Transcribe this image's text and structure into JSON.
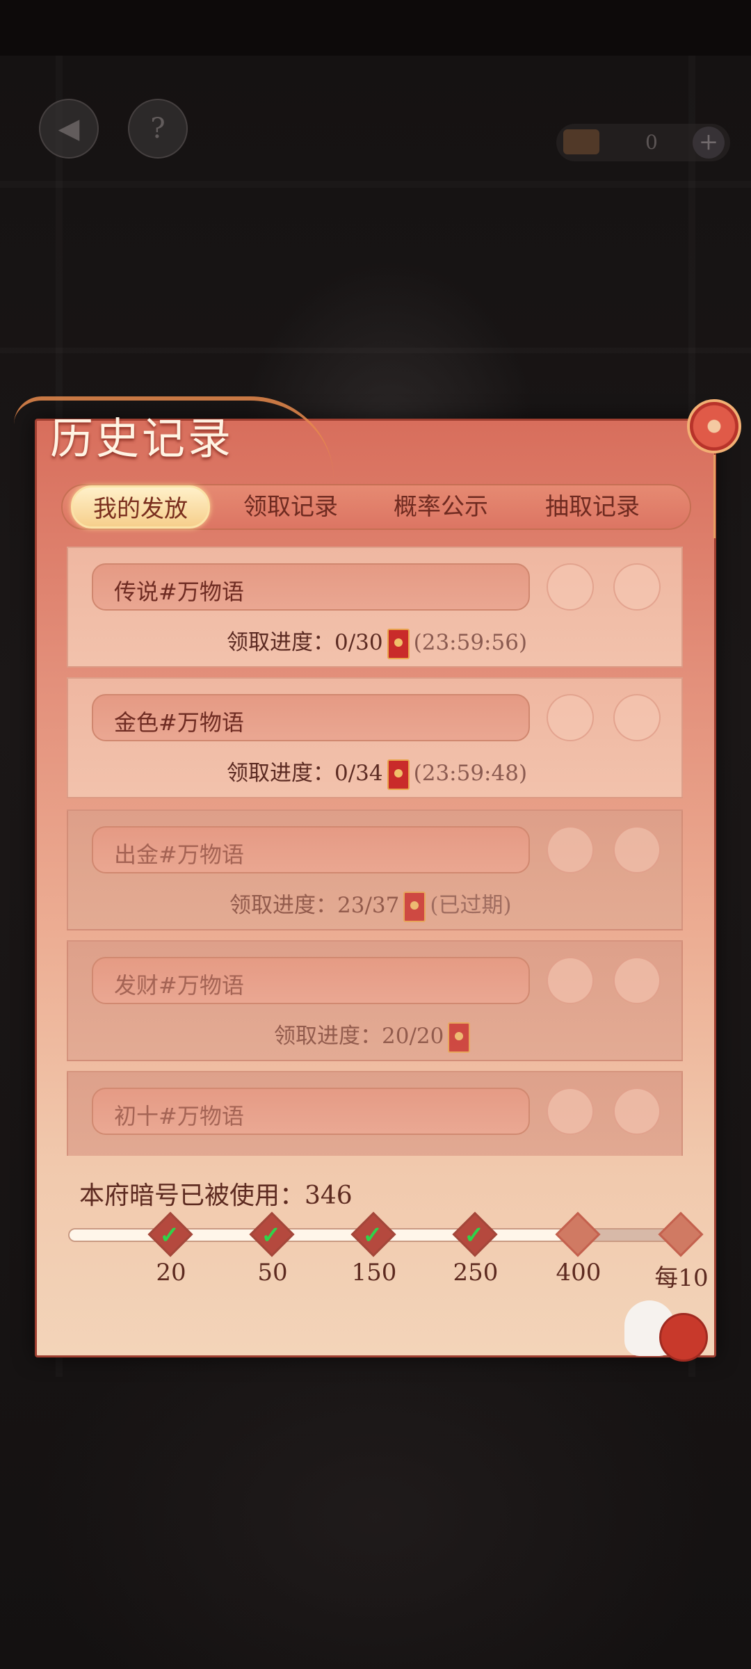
{
  "topbar": {
    "back_icon": "back-arrow-icon",
    "help_label": "?",
    "currency_value": "0",
    "currency_add": "+"
  },
  "panel": {
    "title": "历史记录"
  },
  "tabs": [
    {
      "label": "我的发放",
      "active": true
    },
    {
      "label": "领取记录",
      "active": false
    },
    {
      "label": "概率公示",
      "active": false
    },
    {
      "label": "抽取记录",
      "active": false
    }
  ],
  "records": [
    {
      "code": "传说#万物语",
      "progress_label": "领取进度：",
      "progress": "0/30",
      "note": "(23:59:56)",
      "expired": false
    },
    {
      "code": "金色#万物语",
      "progress_label": "领取进度：",
      "progress": "0/34",
      "note": "(23:59:48)",
      "expired": false
    },
    {
      "code": "出金#万物语",
      "progress_label": "领取进度：",
      "progress": "23/37",
      "note": "(已过期)",
      "expired": true
    },
    {
      "code": "发财#万物语",
      "progress_label": "领取进度：",
      "progress": "20/20",
      "note": "",
      "expired": true
    },
    {
      "code": "初十#万物语",
      "progress_label": "",
      "progress": "",
      "note": "",
      "expired": true
    }
  ],
  "usage": {
    "label": "本府暗号已被使用：",
    "count": "346",
    "text": "本府暗号已被使用：346"
  },
  "milestones": [
    {
      "label": "20",
      "reached": true
    },
    {
      "label": "50",
      "reached": true
    },
    {
      "label": "150",
      "reached": true
    },
    {
      "label": "250",
      "reached": true
    },
    {
      "label": "400",
      "reached": false
    },
    {
      "label": "每10",
      "reached": false
    }
  ],
  "progress_fraction": 0.79,
  "colors": {
    "panel_top": "#d86e5c",
    "panel_bottom": "#f3d4b9",
    "accent_text": "#6e2b22",
    "checkmark": "#2ed44a",
    "red_packet": "#c92b2a"
  }
}
